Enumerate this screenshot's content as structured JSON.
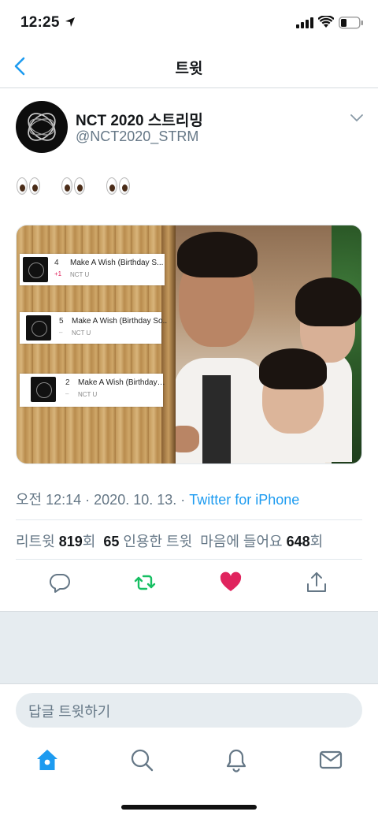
{
  "status_bar": {
    "time": "12:25"
  },
  "nav": {
    "title": "트윗"
  },
  "tweet": {
    "display_name": "NCT 2020 스트리밍",
    "handle": "@NCT2020_STRM",
    "text": "👀 👀 👀",
    "timestamp": "오전 12:14 · 2020. 10. 13. · ",
    "source": "Twitter for iPhone",
    "stats": {
      "retweets_label": "리트윗",
      "retweets": "819",
      "retweets_unit": "회",
      "quotes": "65",
      "quotes_label": "인용한 트윗",
      "likes_label": "마음에 들어요",
      "likes": "648",
      "likes_unit": "회"
    }
  },
  "media": {
    "chart_rows": [
      {
        "rank": "4",
        "change": "+1",
        "title": "Make A Wish (Birthday S...",
        "artist": "NCT U"
      },
      {
        "rank": "5",
        "change": "–",
        "title": "Make A Wish (Birthday So..",
        "artist": "NCT U"
      },
      {
        "rank": "2",
        "change": "–",
        "title": "Make A Wish (Birthday…",
        "artist": "NCT U"
      }
    ]
  },
  "actions": {
    "reply_icon": "reply-icon",
    "retweet_icon": "retweet-icon",
    "like_icon": "heart-icon",
    "share_icon": "share-icon",
    "retweet_color": "#17bf63",
    "like_color": "#e0245e"
  },
  "reply": {
    "placeholder": "답글 트윗하기"
  },
  "tab_bar": {
    "items": [
      "home-icon",
      "search-icon",
      "bell-icon",
      "mail-icon"
    ],
    "active_color": "#1d9bf0"
  }
}
